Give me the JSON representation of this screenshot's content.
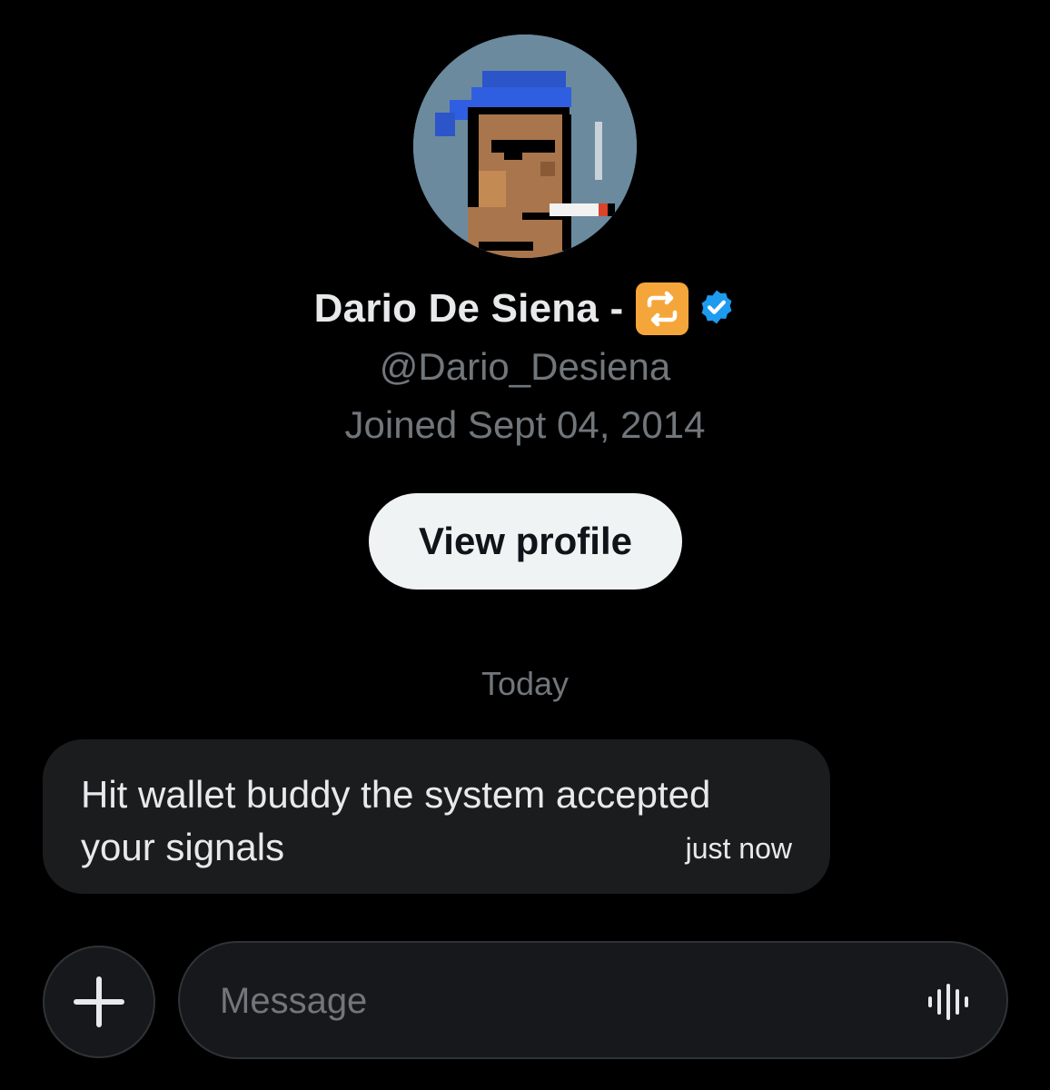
{
  "profile": {
    "name": "Dario De Siena -",
    "handle": "@Dario_Desiena",
    "joined": "Joined Sept 04, 2014",
    "view_profile_label": "View profile",
    "badge_icon": "repeat-emoji-icon",
    "verified_icon": "verified-badge-icon",
    "avatar_icon": "pixel-punk-avatar"
  },
  "conversation": {
    "day_label": "Today",
    "messages": [
      {
        "text": "Hit wallet buddy the system accepted your signals",
        "time": "just now"
      }
    ]
  },
  "composer": {
    "placeholder": "Message",
    "add_icon": "plus-icon",
    "voice_icon": "voice-waveform-icon"
  },
  "colors": {
    "background": "#000000",
    "verified": "#1d9bf0",
    "badge": "#f5a63a",
    "bubble": "#1b1c1e",
    "muted_text": "#71767b"
  }
}
